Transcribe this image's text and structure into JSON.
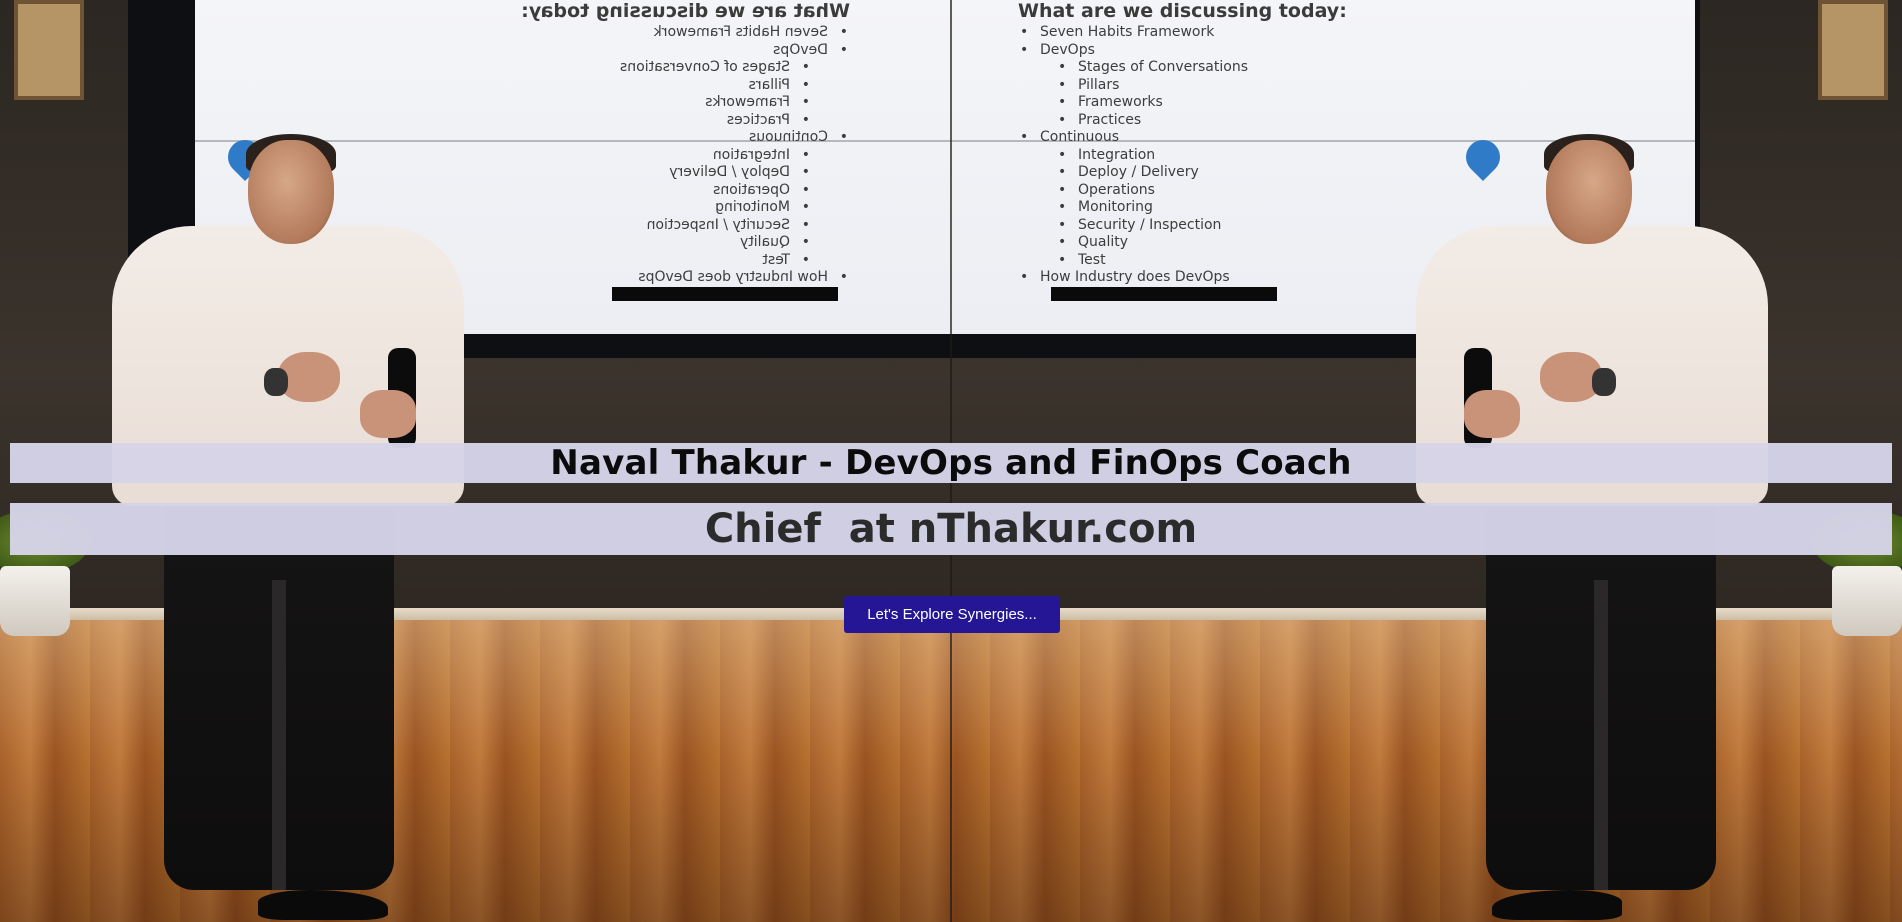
{
  "hero": {
    "name_title": "Naval Thakur - DevOps and FinOps Coach",
    "role_subtitle": "Chief  at nThakur.com",
    "cta_label": "Let's Explore Synergies..."
  },
  "background_slide": {
    "title": "What are we discussing today:",
    "items": [
      {
        "text": "Seven Habits Framework",
        "level": 1
      },
      {
        "text": "DevOps",
        "level": 1
      },
      {
        "text": "Stages of Conversations",
        "level": 2
      },
      {
        "text": "Pillars",
        "level": 2
      },
      {
        "text": "Frameworks",
        "level": 2
      },
      {
        "text": "Practices",
        "level": 2
      },
      {
        "text": "Continuous",
        "level": 1
      },
      {
        "text": "Integration",
        "level": 2
      },
      {
        "text": "Deploy / Delivery",
        "level": 2
      },
      {
        "text": "Operations",
        "level": 2
      },
      {
        "text": "Monitoring",
        "level": 2
      },
      {
        "text": "Security / Inspection",
        "level": 2
      },
      {
        "text": "Quality",
        "level": 2
      },
      {
        "text": "Test",
        "level": 2
      },
      {
        "text": "How Industry does DevOps",
        "level": 1
      }
    ]
  },
  "colors": {
    "band_background": "#D6D4E8",
    "cta_background": "#241694",
    "cta_text": "#FFFFFF"
  }
}
